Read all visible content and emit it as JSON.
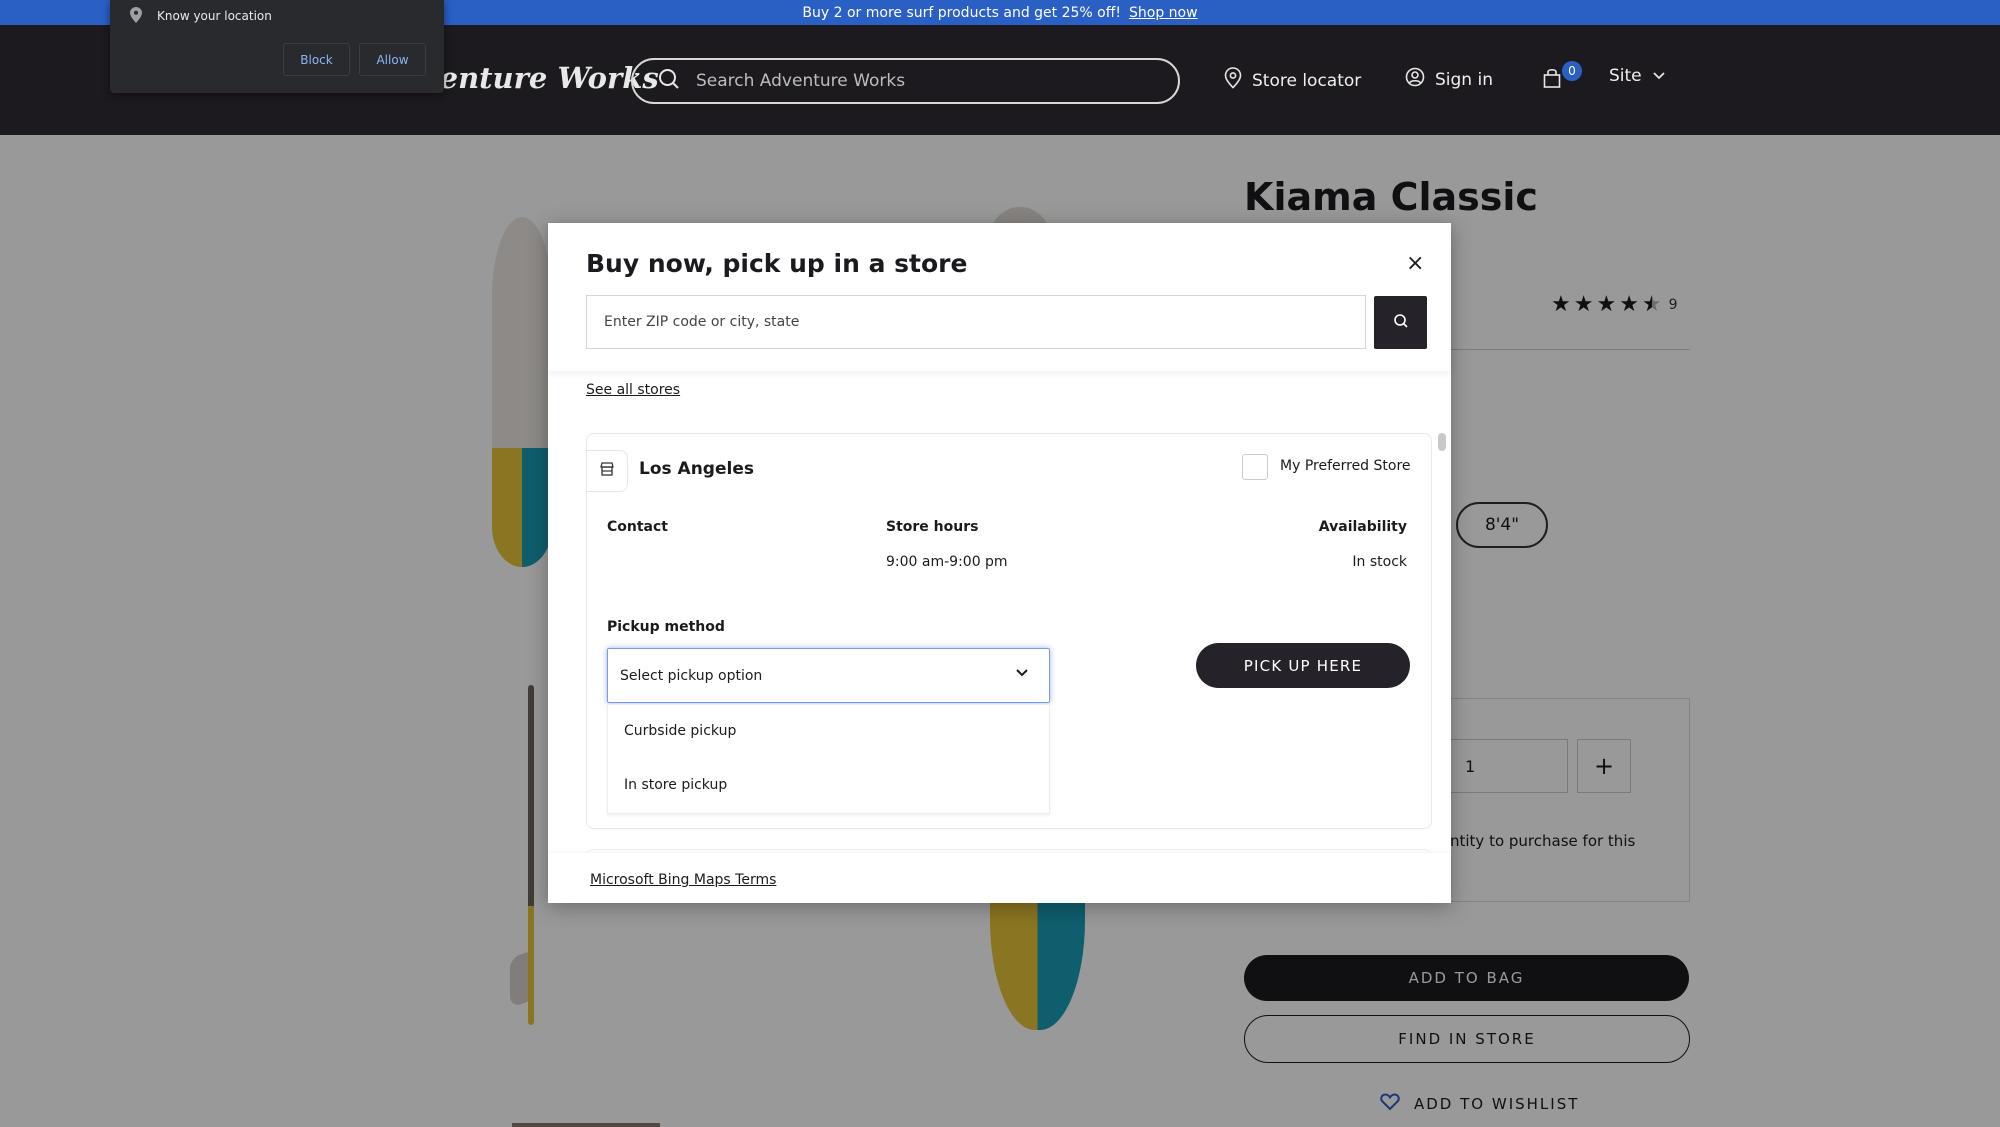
{
  "banner": {
    "text": "Buy 2 or more surf products and get 25% off!",
    "link": "Shop now"
  },
  "header": {
    "logo": "Adventure Works",
    "logo_visible": "ture Works",
    "search_placeholder": "Search Adventure Works",
    "store_locator": "Store locator",
    "sign_in": "Sign in",
    "cart_count": "0",
    "site": "Site"
  },
  "product": {
    "title": "Kiama Classic",
    "rating": 4.5,
    "rating_max": 5,
    "review_count": "9",
    "size_option": "8'4\"",
    "quantity": "1",
    "qty_plus": "+",
    "qty_note": "ntity to purchase for this",
    "add_to_bag": "ADD TO BAG",
    "find_in_store": "FIND IN STORE",
    "add_to_wishlist": "ADD TO WISHLIST"
  },
  "modal": {
    "title": "Buy now, pick up in a store",
    "close": "×",
    "zip_placeholder": "Enter ZIP code or city, state",
    "see_all_stores": "See all stores",
    "store": {
      "name": "Los Angeles",
      "preferred_label": "My Preferred Store",
      "preferred_checked": false,
      "contact_label": "Contact",
      "contact_value": "",
      "hours_label": "Store hours",
      "hours_value": "9:00 am-9:00 pm",
      "availability_label": "Availability",
      "availability_value": "In stock",
      "pickup_label": "Pickup method",
      "pickup_selected": "Select pickup option",
      "pickup_options": [
        "Curbside pickup",
        "In store pickup"
      ],
      "pickup_button": "PICK UP HERE"
    },
    "footer_link": "Microsoft Bing Maps Terms"
  },
  "permission_popup": {
    "text": "Know your location",
    "block": "Block",
    "allow": "Allow"
  },
  "colors": {
    "banner": "#2a5fc4",
    "header": "#1c1a1e",
    "primary_button": "#25222a",
    "focus_ring": "#7a9be8"
  }
}
